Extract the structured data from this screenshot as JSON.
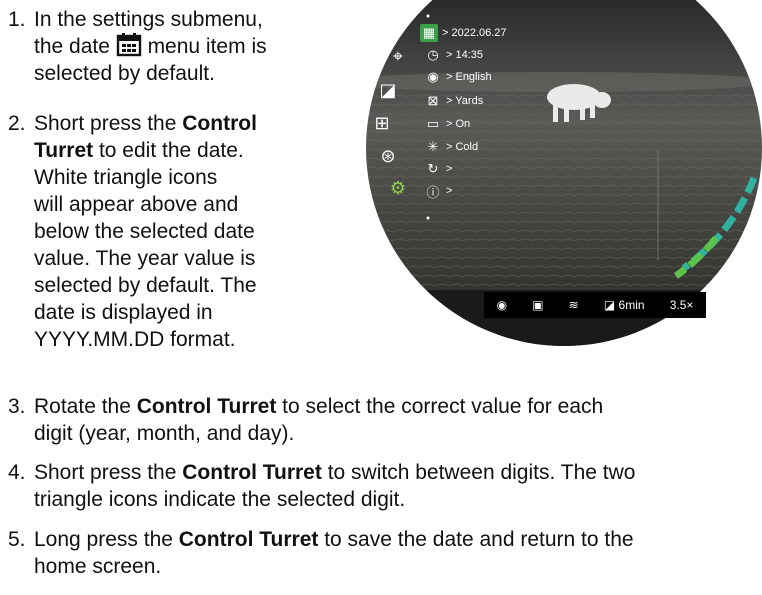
{
  "steps": [
    {
      "num": "1.",
      "lines": [
        [
          "In the settings submenu,"
        ],
        [
          "the date ",
          "[icon]",
          " menu item is"
        ],
        [
          "selected by default."
        ]
      ]
    },
    {
      "num": "2.",
      "lines": []
    }
  ],
  "step1": {
    "num": "1.",
    "l1": "In the settings submenu,",
    "l2a": "the date ",
    "l2b": " menu item is",
    "l3": "selected by default."
  },
  "step2": {
    "num": "2.",
    "l1a": "Short press the ",
    "l1b": "Control",
    "l2a": "Turret",
    "l2b": " to edit the date.",
    "l3": "White triangle icons",
    "l4": "will appear above and",
    "l5": "below the selected date",
    "l6": "value. The year value is",
    "l7": "selected by default. The",
    "l8": "date is displayed in",
    "l9": "YYYY.MM.DD format."
  },
  "step3": {
    "num": "3.",
    "l1a": "Rotate the ",
    "l1b": "Control Turret",
    "l1c": " to select the correct value for each",
    "l2": "digit (year, month, and day)."
  },
  "step4": {
    "num": "4.",
    "l1a": "Short press the ",
    "l1b": "Control Turret",
    "l1c": " to switch between digits. The two",
    "l2": "triangle icons indicate the selected digit."
  },
  "step5": {
    "num": "5.",
    "l1a": "Long press the ",
    "l1b": "Control Turret",
    "l1c": " to save the date and return to the",
    "l2": "home screen."
  },
  "scope": {
    "menu": [
      {
        "icon": "calendar-icon",
        "glyph": "▦",
        "label": "> 2022.06.27",
        "selected": true
      },
      {
        "icon": "clock-icon",
        "glyph": "◷",
        "label": "> 14:35"
      },
      {
        "icon": "globe-icon",
        "glyph": "◉",
        "label": "> English"
      },
      {
        "icon": "units-icon",
        "glyph": "⊠",
        "label": "> Yards"
      },
      {
        "icon": "display-icon",
        "glyph": "▭",
        "label": "> On"
      },
      {
        "icon": "palette-icon",
        "glyph": "✳",
        "label": "> Cold"
      },
      {
        "icon": "reset-icon",
        "glyph": "↻",
        "label": ">"
      },
      {
        "icon": "info-icon",
        "glyph": "ⓘ",
        "label": ">"
      }
    ],
    "status": {
      "battery": "6min",
      "zoom": "3.5×"
    },
    "colors": {
      "selected": "#3aa04a",
      "active_icon": "#8fd14f",
      "arc_teal": "#2fb3a0",
      "arc_green": "#5cc24a"
    }
  }
}
